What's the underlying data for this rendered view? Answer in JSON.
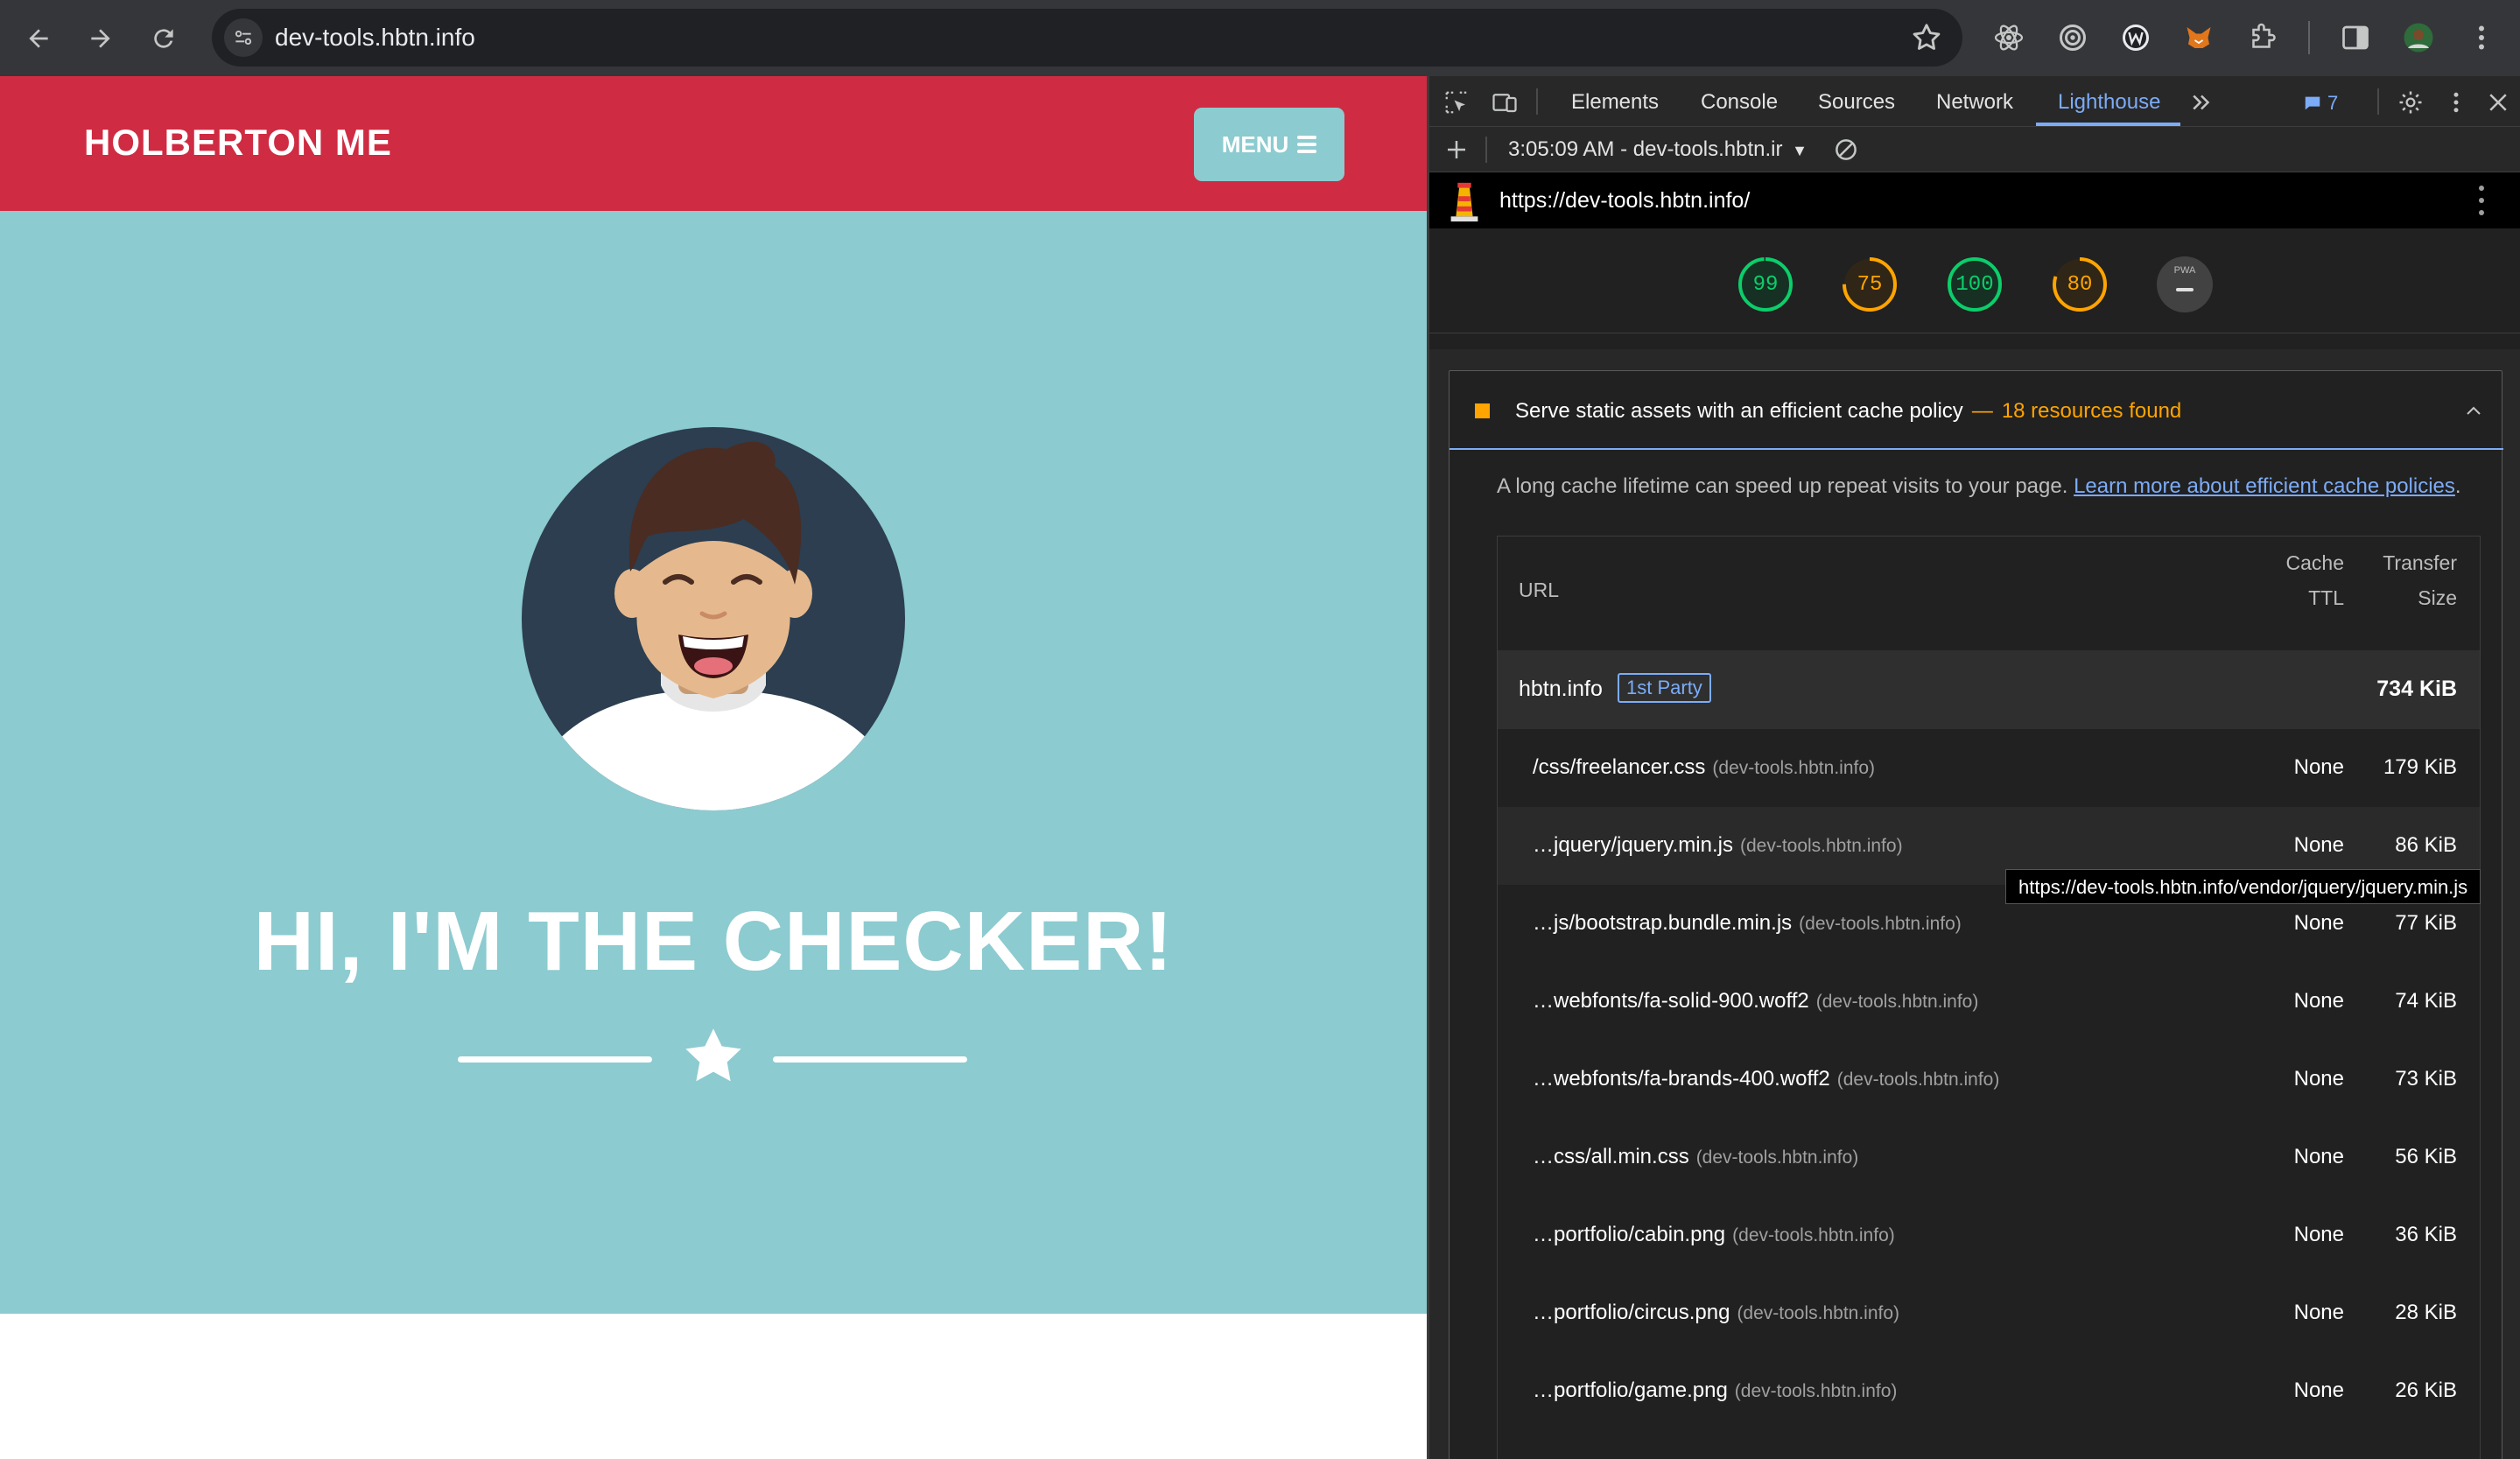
{
  "browser": {
    "url": "dev-tools.hbtn.info",
    "back_icon": "arrow-left-icon",
    "forward_icon": "arrow-right-icon",
    "reload_icon": "reload-icon"
  },
  "site": {
    "brand": "HOLBERTON ME",
    "menu_label": "MENU",
    "hero_title": "HI, I'M THE CHECKER!",
    "colors": {
      "header": "#cf2b42",
      "hero": "#8ccbd0",
      "menu": "#8ccbd0"
    }
  },
  "devtools": {
    "tabs": [
      "Elements",
      "Console",
      "Sources",
      "Network",
      "Lighthouse"
    ],
    "active_tab": "Lighthouse",
    "message_count": "7",
    "report_label": "3:05:09 AM - dev-tools.hbtn.ir",
    "lighthouse_url": "https://dev-tools.hbtn.info/",
    "scores": [
      {
        "value": 99,
        "label": "99",
        "color": "#0cce6b"
      },
      {
        "value": 75,
        "label": "75",
        "color": "#ffa400"
      },
      {
        "value": 100,
        "label": "100",
        "color": "#0cce6b"
      },
      {
        "value": 80,
        "label": "80",
        "color": "#ffa400"
      }
    ],
    "pwa_label": "PWA",
    "audit": {
      "title": "Serve static assets with an efficient cache policy",
      "found": "18 resources found",
      "description": "A long cache lifetime can speed up repeat visits to your page.",
      "link_text": "Learn more about efficient cache policies",
      "columns": {
        "url": "URL",
        "ttl_1": "Cache",
        "ttl_2": "TTL",
        "size_1": "Transfer",
        "size_2": "Size"
      },
      "group": {
        "name": "hbtn.info",
        "badge": "1st Party",
        "size": "734 KiB"
      },
      "rows": [
        {
          "url": "/css/freelancer.css",
          "origin": "(dev-tools.hbtn.info)",
          "ttl": "None",
          "size": "179 KiB"
        },
        {
          "url": "…jquery/jquery.min.js",
          "origin": "(dev-tools.hbtn.info)",
          "ttl": "None",
          "size": "86 KiB"
        },
        {
          "url": "…js/bootstrap.bundle.min.js",
          "origin": "(dev-tools.hbtn.info)",
          "ttl": "None",
          "size": "77 KiB"
        },
        {
          "url": "…webfonts/fa-solid-900.woff2",
          "origin": "(dev-tools.hbtn.info)",
          "ttl": "None",
          "size": "74 KiB"
        },
        {
          "url": "…webfonts/fa-brands-400.woff2",
          "origin": "(dev-tools.hbtn.info)",
          "ttl": "None",
          "size": "73 KiB"
        },
        {
          "url": "…css/all.min.css",
          "origin": "(dev-tools.hbtn.info)",
          "ttl": "None",
          "size": "56 KiB"
        },
        {
          "url": "…portfolio/cabin.png",
          "origin": "(dev-tools.hbtn.info)",
          "ttl": "None",
          "size": "36 KiB"
        },
        {
          "url": "…portfolio/circus.png",
          "origin": "(dev-tools.hbtn.info)",
          "ttl": "None",
          "size": "28 KiB"
        },
        {
          "url": "…portfolio/game.png",
          "origin": "(dev-tools.hbtn.info)",
          "ttl": "None",
          "size": "26 KiB"
        }
      ],
      "tooltip": "https://dev-tools.hbtn.info/vendor/jquery/jquery.min.js"
    }
  }
}
